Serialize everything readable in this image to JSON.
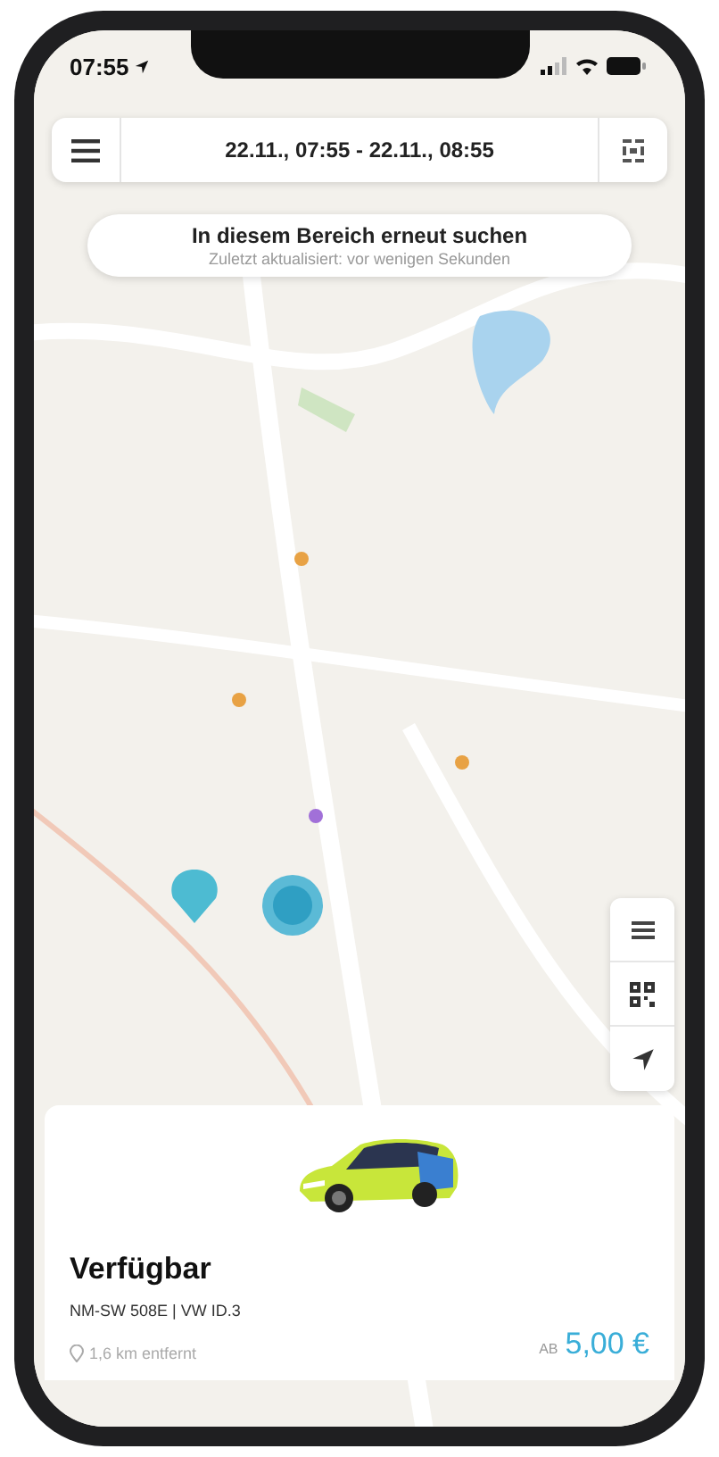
{
  "status_bar": {
    "time": "07:55"
  },
  "header": {
    "date_range": "22.11., 07:55 - 22.11., 08:55"
  },
  "search_area": {
    "title": "In diesem Bereich erneut suchen",
    "subtitle": "Zuletzt aktualisiert: vor wenigen Sekunden"
  },
  "vehicle_card": {
    "status": "Verfügbar",
    "vehicle": "NM-SW 508E | VW ID.3",
    "distance": "1,6 km entfernt",
    "price_prefix": "AB",
    "price": "5,00 €"
  }
}
